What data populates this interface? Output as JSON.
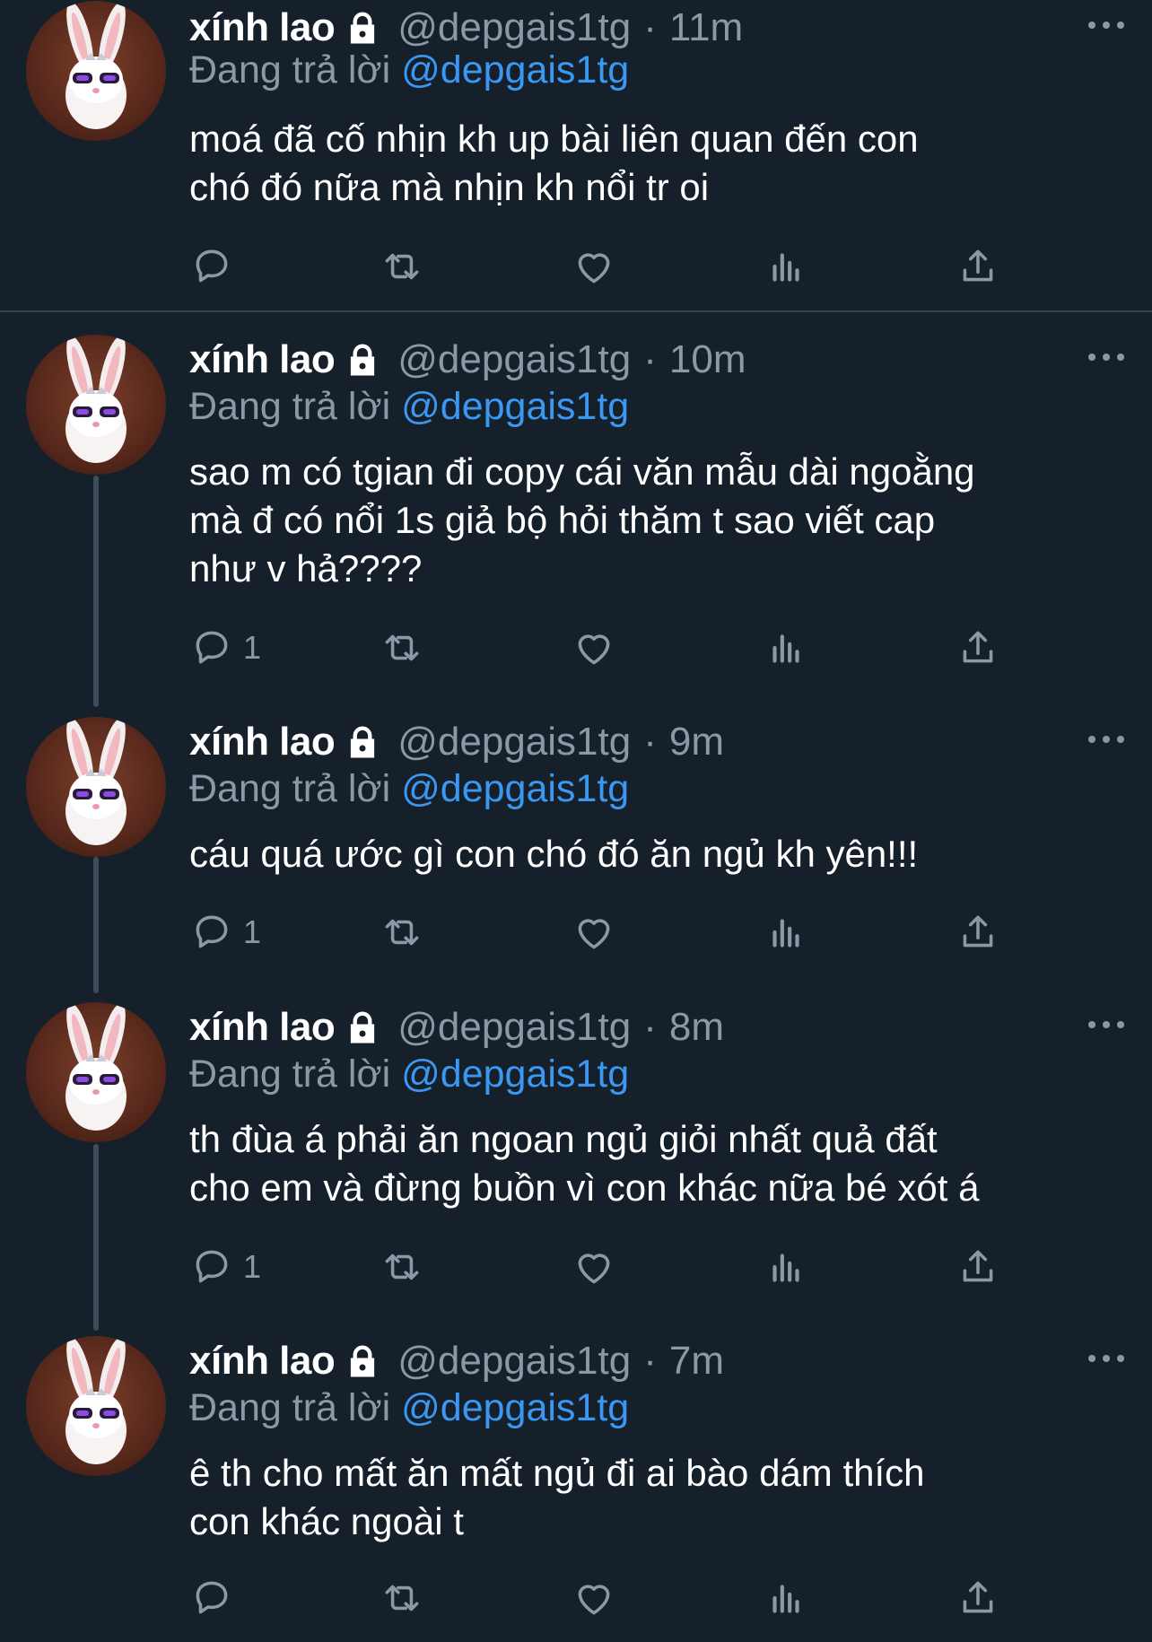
{
  "colors": {
    "background": "#15202b",
    "text": "#ffffff",
    "muted": "#8b98a5",
    "mention": "#3b98f2",
    "thread_line": "#3d4d5c"
  },
  "replying_prefix": "Đang trả lời",
  "tweets": [
    {
      "name": "xính lao",
      "handle": "@depgais1tg",
      "separator": "·",
      "time": "11m",
      "reply_to": "@depgais1tg",
      "text": "moá đã cố nhịn kh up bài liên quan đến con\nchó đó nữa mà nhịn kh nổi tr oi",
      "reply_count": ""
    },
    {
      "name": "xính lao",
      "handle": "@depgais1tg",
      "separator": "·",
      "time": "10m",
      "reply_to": "@depgais1tg",
      "text": "sao m có tgian đi copy cái văn mẫu dài ngoằng\nmà đ có nổi 1s giả bộ hỏi thăm t sao viết cap\nnhư v hả????",
      "reply_count": "1"
    },
    {
      "name": "xính lao",
      "handle": "@depgais1tg",
      "separator": "·",
      "time": "9m",
      "reply_to": "@depgais1tg",
      "text": "cáu quá ước gì con chó đó ăn ngủ kh yên!!!",
      "reply_count": "1"
    },
    {
      "name": "xính lao",
      "handle": "@depgais1tg",
      "separator": "·",
      "time": "8m",
      "reply_to": "@depgais1tg",
      "text": "th đùa á phải ăn ngoan ngủ giỏi nhất quả đất\ncho em và đừng buồn vì con khác nữa bé xót á",
      "reply_count": "1"
    },
    {
      "name": "xính lao",
      "handle": "@depgais1tg",
      "separator": "·",
      "time": "7m",
      "reply_to": "@depgais1tg",
      "text": "ê th cho mất ăn mất ngủ đi ai bào dám thích\ncon khác ngoài t",
      "reply_count": ""
    }
  ],
  "icons": {
    "lock": "lock-icon",
    "more": "more-icon",
    "reply": "reply-icon",
    "retweet": "retweet-icon",
    "like": "heart-icon",
    "views": "views-icon",
    "share": "share-icon"
  }
}
